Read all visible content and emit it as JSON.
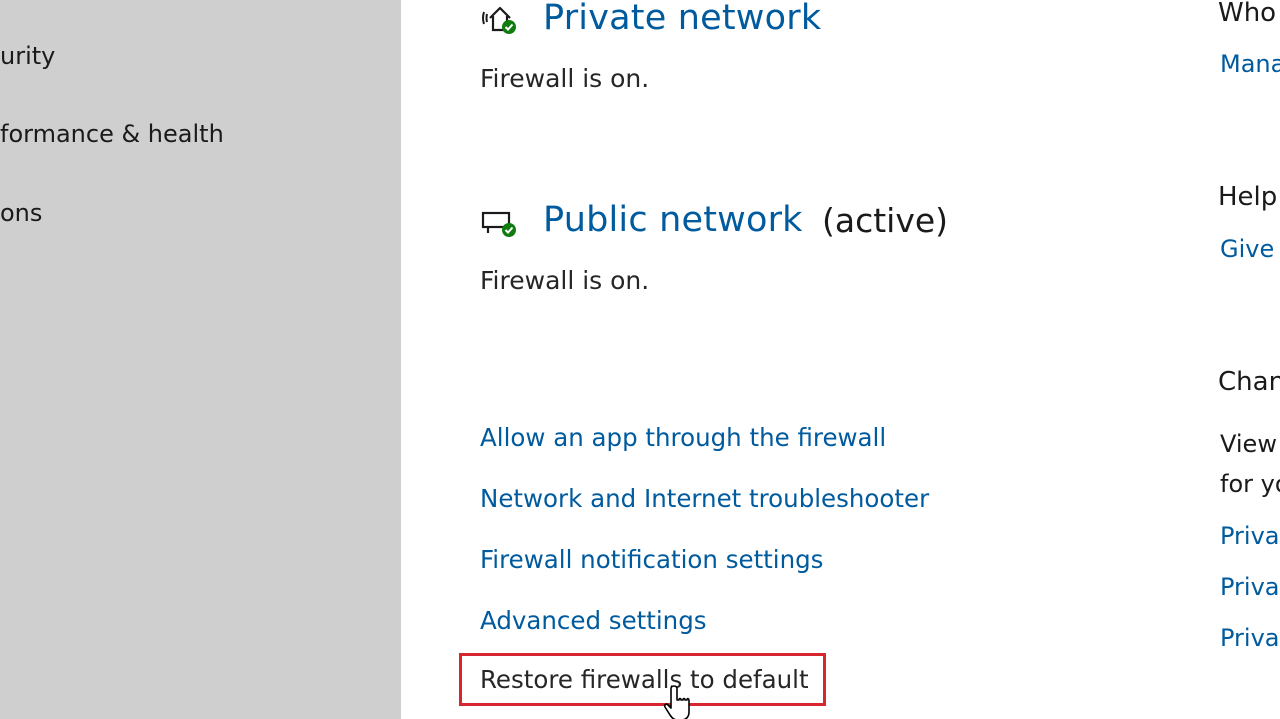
{
  "sidebar": {
    "items": [
      {
        "label": "urity"
      },
      {
        "label": "formance & health"
      },
      {
        "label": "ons"
      }
    ]
  },
  "networks": {
    "private": {
      "title": "Private network",
      "status": "Firewall is on."
    },
    "public": {
      "title": "Public network",
      "active_tag": "(active)",
      "status": "Firewall is on."
    }
  },
  "links": {
    "allow_app": "Allow an app through the firewall",
    "troubleshooter": "Network and Internet troubleshooter",
    "notification_settings": "Firewall notification settings",
    "advanced_settings": "Advanced settings",
    "restore_defaults": "Restore firewalls to default"
  },
  "right_column": {
    "who_heading": "Who",
    "manage_link": "Mana",
    "help_heading": "Help",
    "give_link": "Give",
    "change_heading": "Chan",
    "view_line1": "View",
    "view_line2": "for yo",
    "privacy_links": [
      "Privac",
      "Privac",
      "Privac"
    ]
  },
  "colors": {
    "link_blue": "#005a9e",
    "sidebar_bg": "#cfcfcf",
    "highlight_red": "#d7262f",
    "status_green": "#107c10"
  },
  "icons": {
    "private_network": "private-network-icon",
    "public_network": "public-network-icon",
    "cursor": "hand-cursor-icon"
  }
}
